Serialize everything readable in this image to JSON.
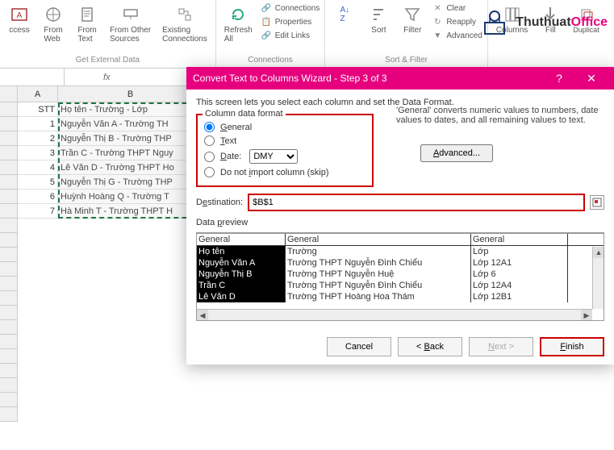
{
  "ribbon": {
    "group1": {
      "label": "Get External Data",
      "items": [
        "ccess",
        "From\nWeb",
        "From\nText",
        "From Other\nSources",
        "Existing\nConnections"
      ]
    },
    "group2": {
      "label": "Connections",
      "refresh": "Refresh\nAll",
      "conn": "Connections",
      "prop": "Properties",
      "edit": "Edit Links"
    },
    "group3": {
      "label": "Sort & Filter",
      "sort": "Sort",
      "filter": "Filter",
      "clear": "Clear",
      "reapply": "Reapply",
      "adv": "Advanced"
    },
    "group4": {
      "colu": "Columns",
      "flash": "Flash\nFill",
      "remove": "Remove\nDuplicat",
      "fill": "Fill"
    }
  },
  "watermark": "ThuthuatOffice",
  "namebox": "",
  "fx": "fx",
  "columns": [
    "A",
    "B"
  ],
  "sheet": {
    "header_stt": "STT",
    "header_name": "Họ tên - Trường - Lớp",
    "rows": [
      {
        "n": "1",
        "t": "Nguyễn Văn A - Trường TH"
      },
      {
        "n": "2",
        "t": "Nguyễn Thị B - Trường THP"
      },
      {
        "n": "3",
        "t": "Trần C - Trường THPT Nguy"
      },
      {
        "n": "4",
        "t": "Lê Văn D - Trường THPT Ho"
      },
      {
        "n": "5",
        "t": "Nguyễn Thị G - Trường THP"
      },
      {
        "n": "6",
        "t": "Huỳnh Hoàng Q - Trường T"
      },
      {
        "n": "7",
        "t": "Hà Minh T - Trường THPT H"
      }
    ]
  },
  "dialog": {
    "title": "Convert Text to Columns Wizard - Step 3 of 3",
    "help": "?",
    "close": "✕",
    "instruction": "This screen lets you select each column and set the Data Format.",
    "format_legend": "Column data format",
    "opt_general": "General",
    "opt_text": "Text",
    "opt_date": "Date:",
    "date_value": "DMY",
    "opt_skip": "Do not import column (skip)",
    "general_help": "'General' converts numeric values to numbers, date values to dates, and all remaining values to text.",
    "advanced": "Advanced...",
    "dest_label": "Destination:",
    "dest_value": "$B$1",
    "preview_label": "Data preview",
    "preview_headers": [
      "General",
      "General",
      "General"
    ],
    "preview_rows": [
      [
        "Họ tên",
        "Trường",
        "Lớp"
      ],
      [
        "Nguyễn Văn A",
        "Trường THPT Nguyễn Đình Chiểu",
        "Lớp 12A1"
      ],
      [
        "Nguyễn Thị B",
        "Trường THPT Nguyễn Huệ",
        "Lớp 6"
      ],
      [
        "Trần C",
        "Trường THPT Nguyễn Đình Chiểu",
        "Lớp 12A4"
      ],
      [
        "Lê Văn D",
        "Trường THPT Hoàng Hoa Thám",
        "Lớp 12B1"
      ]
    ],
    "btn_cancel": "Cancel",
    "btn_back": "< Back",
    "btn_next": "Next >",
    "btn_finish": "Finish"
  }
}
